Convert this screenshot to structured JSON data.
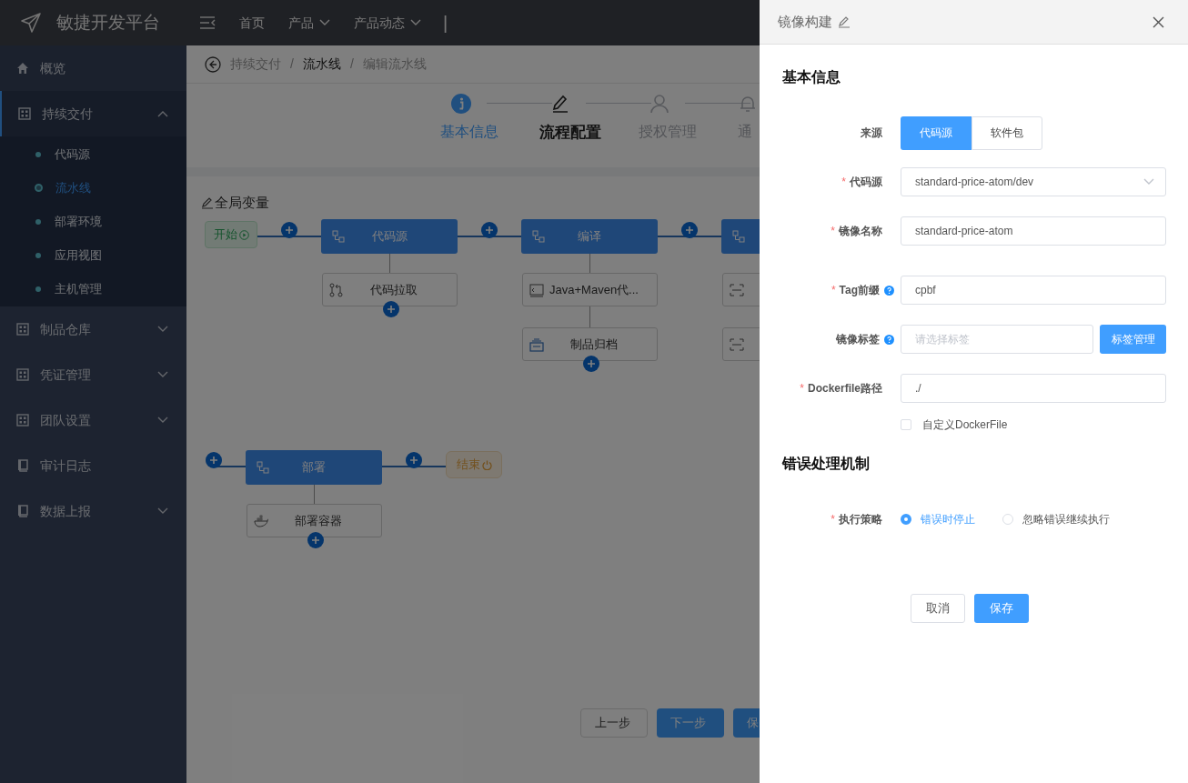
{
  "header": {
    "logo": "敏捷开发平台",
    "nav": [
      {
        "label": "首页",
        "dropdown": false
      },
      {
        "label": "产品",
        "dropdown": true
      },
      {
        "label": "产品动态",
        "dropdown": true
      }
    ],
    "separator": "|"
  },
  "sidebar": {
    "items": [
      {
        "label": "概览"
      },
      {
        "label": "持续交付",
        "expanded": true,
        "children": [
          {
            "label": "代码源",
            "selected": false
          },
          {
            "label": "流水线",
            "selected": true
          },
          {
            "label": "部署环境",
            "selected": false
          },
          {
            "label": "应用视图",
            "selected": false
          },
          {
            "label": "主机管理",
            "selected": false
          }
        ]
      },
      {
        "label": "制品仓库",
        "expanded": false
      },
      {
        "label": "凭证管理",
        "expanded": false
      },
      {
        "label": "团队设置",
        "expanded": false
      },
      {
        "label": "审计日志"
      },
      {
        "label": "数据上报",
        "expanded": false
      }
    ]
  },
  "breadcrumb": {
    "separator": "/",
    "items": [
      "持续交付",
      "流水线",
      "编辑流水线"
    ]
  },
  "steps": [
    {
      "label": "基本信息",
      "done": true,
      "selected": false
    },
    {
      "label": "流程配置",
      "done": false,
      "selected": true
    },
    {
      "label": "授权管理",
      "done": false,
      "selected": false
    },
    {
      "label": "通",
      "done": false,
      "selected": false
    }
  ],
  "global_vars": "全局变量",
  "pipeline": {
    "start": "开始",
    "end": "结束",
    "rows": [
      {
        "stages": [
          {
            "name": "代码源",
            "tasks": [
              {
                "name": "代码拉取",
                "kind": "git"
              }
            ]
          },
          {
            "name": "编译",
            "tasks": [
              {
                "name": "Java+Maven代...",
                "kind": "terminal"
              },
              {
                "name": "制品归档",
                "kind": "archive"
              }
            ]
          },
          {
            "tasks": [
              {
                "kind": "scan"
              },
              {
                "kind": "scan"
              }
            ]
          }
        ]
      },
      {
        "stages": [
          {
            "name": "部署",
            "tasks": [
              {
                "name": "部署容器",
                "kind": "docker"
              }
            ]
          }
        ]
      }
    ]
  },
  "footer_buttons": [
    {
      "label": "上一步",
      "primary": false
    },
    {
      "label": "下一步",
      "primary": true
    },
    {
      "label": "保",
      "primary": true
    }
  ],
  "drawer": {
    "title": "镜像构建",
    "required_mark": "*",
    "sections": [
      {
        "title": "基本信息",
        "fields": [
          {
            "kind": "segmented",
            "label": "来源",
            "required": false,
            "options": [
              {
                "label": "代码源",
                "selected": true
              },
              {
                "label": "软件包",
                "selected": false
              }
            ]
          },
          {
            "kind": "select",
            "label": "代码源",
            "required": true,
            "value": "standard-price-atom/dev"
          },
          {
            "kind": "input",
            "label": "镜像名称",
            "required": true,
            "value": "standard-price-atom"
          },
          {
            "kind": "input",
            "label": "Tag前缀",
            "required": true,
            "help": true,
            "value": "cpbf"
          },
          {
            "kind": "input-button",
            "label": "镜像标签",
            "required": false,
            "help": true,
            "placeholder": "请选择标签",
            "button": "标签管理"
          },
          {
            "kind": "input",
            "label": "Dockerfile路径",
            "required": true,
            "value": "./"
          },
          {
            "kind": "checkbox",
            "text": "自定义DockerFile",
            "checked": false
          }
        ]
      },
      {
        "title": "错误处理机制",
        "fields": [
          {
            "kind": "radio",
            "label": "执行策略",
            "required": true,
            "options": [
              {
                "label": "错误时停止",
                "selected": true
              },
              {
                "label": "忽略错误继续执行",
                "selected": false
              }
            ]
          }
        ]
      }
    ],
    "buttons": [
      {
        "label": "取消",
        "primary": false
      },
      {
        "label": "保存",
        "primary": true
      }
    ]
  }
}
